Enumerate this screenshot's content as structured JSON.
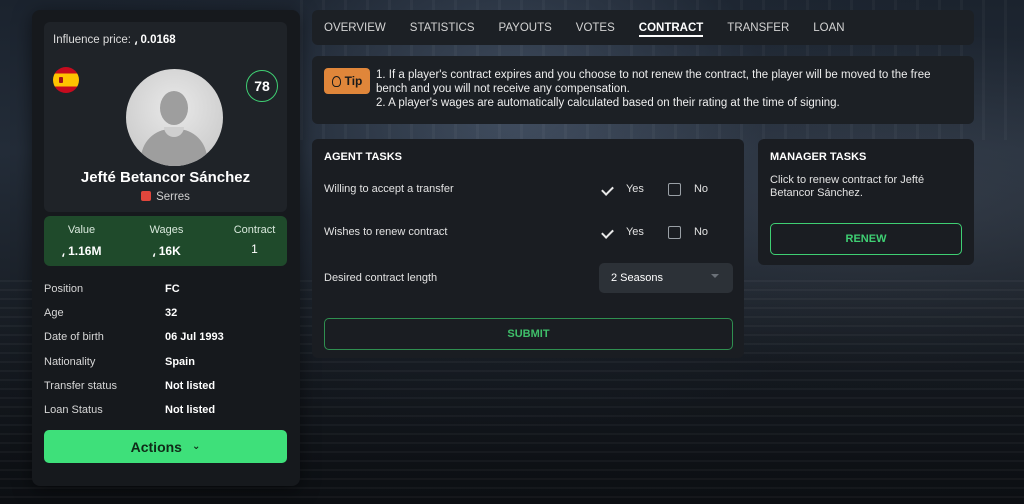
{
  "profile": {
    "influence_label": "Influence price:",
    "influence_value": "0.0168",
    "currency_symbol": "⸲",
    "rating": "78",
    "name": "Jefté Betancor Sánchez",
    "club": "Serres",
    "nation_flag_icon": "spain-flag-icon"
  },
  "stats": {
    "value_label": "Value",
    "value": "⸲ 1.16M",
    "wages_label": "Wages",
    "wages": "⸲ 16K",
    "contract_label": "Contract",
    "contract": "1"
  },
  "info": [
    {
      "key": "Position",
      "value": "FC"
    },
    {
      "key": "Age",
      "value": "32"
    },
    {
      "key": "Date of birth",
      "value": "06 Jul 1993"
    },
    {
      "key": "Nationality",
      "value": "Spain"
    },
    {
      "key": "Transfer status",
      "value": "Not listed"
    },
    {
      "key": "Loan Status",
      "value": "Not listed"
    }
  ],
  "actions_label": "Actions",
  "tabs": [
    {
      "label": "OVERVIEW"
    },
    {
      "label": "STATISTICS"
    },
    {
      "label": "PAYOUTS"
    },
    {
      "label": "VOTES"
    },
    {
      "label": "CONTRACT",
      "active": true
    },
    {
      "label": "TRANSFER"
    },
    {
      "label": "LOAN"
    }
  ],
  "tip": {
    "badge": "Tip",
    "line1": "1. If a player's contract expires and you choose to not renew the contract, the player will be moved to the free bench and you will not receive any compensation.",
    "line2": "2. A player's wages are automatically calculated based on their rating at the time of  signing."
  },
  "agent": {
    "title": "AGENT TASKS",
    "q1": "Willing to accept a transfer",
    "q2": "Wishes to renew contract",
    "q3": "Desired contract length",
    "yes": "Yes",
    "no": "No",
    "contract_length": "2 Seasons",
    "submit": "SUBMIT",
    "q1_yes_checked": true,
    "q2_yes_checked": true
  },
  "manager": {
    "title": "MANAGER TASKS",
    "text": "Click to renew contract for Jefté Betancor Sánchez.",
    "renew": "RENEW"
  },
  "colors": {
    "accent_green": "#3ee07a",
    "tip_orange": "#e0863a",
    "value_bar_green": "#1f4a2b"
  }
}
